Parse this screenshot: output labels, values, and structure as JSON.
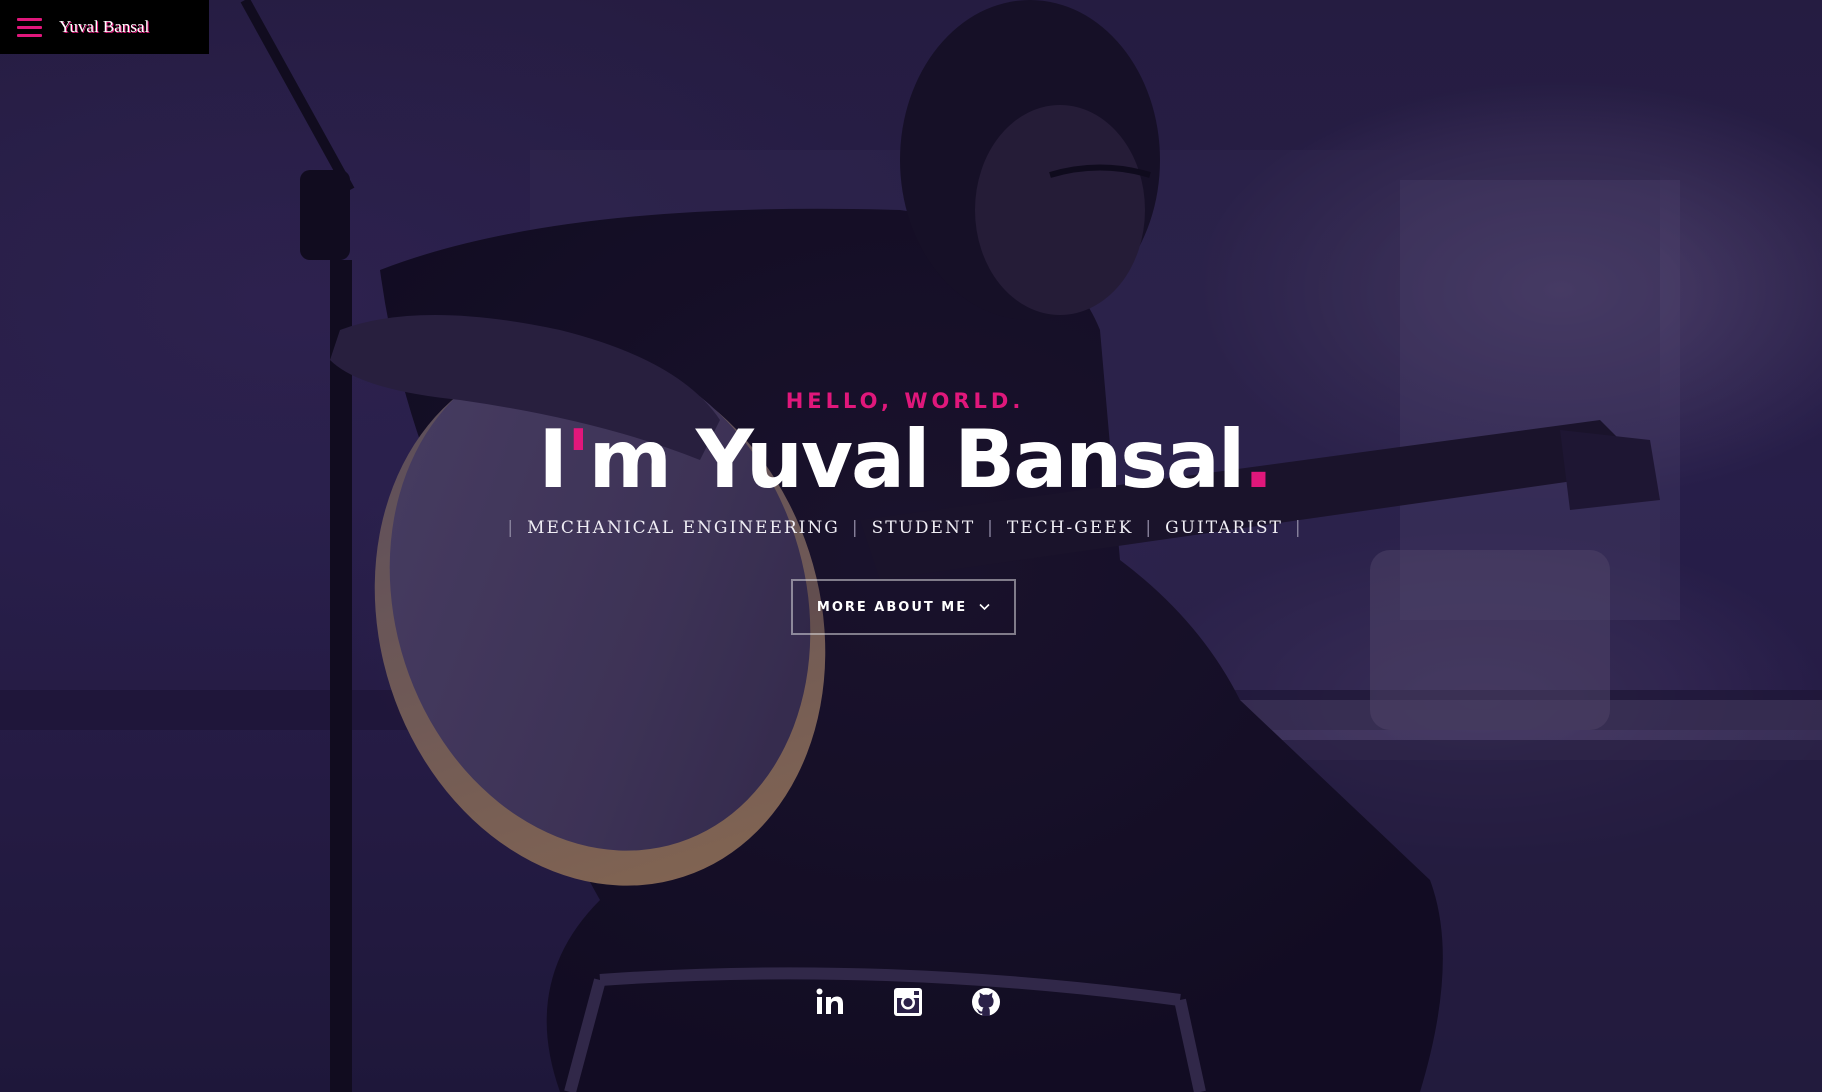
{
  "nav": {
    "brand": "Yuval Bansal",
    "menu_icon": "hamburger-menu-icon"
  },
  "intro": {
    "greeting": "HELLO, WORLD.",
    "title_I": "I",
    "title_apostrophe": "'",
    "title_rest": "m Yuval Bansal",
    "title_period": ".",
    "roles": [
      "MECHANICAL ENGINEERING",
      "STUDENT",
      "TECH-GEEK",
      "GUITARIST"
    ],
    "role_separator": "|"
  },
  "button": {
    "label": "MORE ABOUT ME",
    "icon": "chevron-down-icon"
  },
  "social": [
    {
      "name": "linkedin",
      "icon": "linkedin-icon"
    },
    {
      "name": "instagram",
      "icon": "instagram-icon"
    },
    {
      "name": "github",
      "icon": "github-icon"
    }
  ],
  "colors": {
    "accent": "#e0177b",
    "text": "#ffffff",
    "overlay": "#2b2148"
  }
}
